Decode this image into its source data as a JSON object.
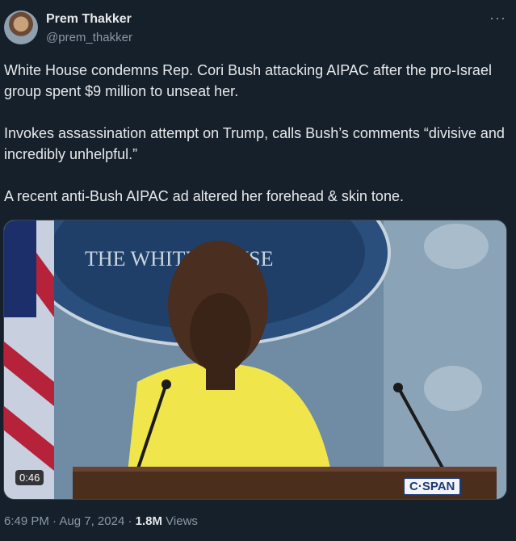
{
  "author": {
    "name": "Prem Thakker",
    "handle": "@prem_thakker"
  },
  "tweet": {
    "paragraphs": [
      "White House condemns Rep. Cori Bush attacking AIPAC after the pro-Israel group spent $9 million to unseat her.",
      "Invokes assassination attempt on Trump, calls Bush’s comments “divisive and incredibly unhelpful.”",
      "A recent anti-Bush AIPAC ad altered her forehead & skin tone."
    ]
  },
  "media": {
    "duration": "0:46",
    "watermark": "C·SPAN",
    "seal_text": "THE WHITE HOUSE"
  },
  "meta": {
    "time": "6:49 PM",
    "separator1": " · ",
    "date": "Aug 7, 2024",
    "separator2": " · ",
    "views": "1.8M",
    "views_label": " Views"
  },
  "icons": {
    "more": "more-options-icon"
  }
}
